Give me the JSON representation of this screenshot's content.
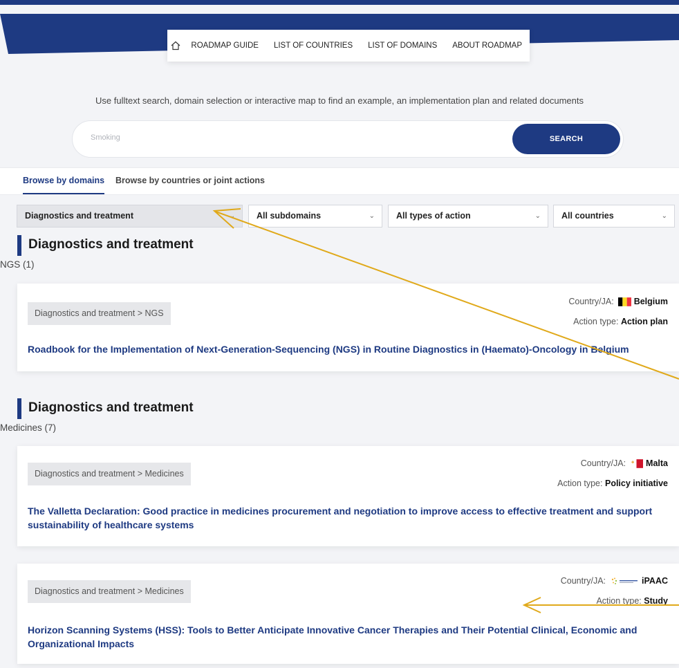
{
  "colors": {
    "brand": "#1e3a82",
    "annotation": "#e0a91a"
  },
  "nav": {
    "home_icon": "home-icon",
    "items": [
      {
        "label": "ROADMAP GUIDE"
      },
      {
        "label": "LIST OF COUNTRIES"
      },
      {
        "label": "LIST OF DOMAINS"
      },
      {
        "label": "ABOUT ROADMAP"
      }
    ]
  },
  "intro_text": "Use fulltext search, domain selection or interactive map to find an example, an implementation plan and related documents",
  "search": {
    "placeholder": "Smoking",
    "value": "",
    "button_label": "SEARCH"
  },
  "tabs": [
    {
      "label": "Browse by domains",
      "active": true
    },
    {
      "label": "Browse by countries or joint actions",
      "active": false
    }
  ],
  "filters": [
    {
      "label": "Diagnostics and treatment"
    },
    {
      "label": "All subdomains"
    },
    {
      "label": "All types of action"
    },
    {
      "label": "All countries"
    }
  ],
  "sections": [
    {
      "title": "Diagnostics and treatment",
      "subtitle": "NGS (1)",
      "cards": [
        {
          "crumb": "Diagnostics and treatment > NGS",
          "country_label": "Country/JA:",
          "country": "Belgium",
          "flag": "belgium-flag",
          "action_label": "Action type:",
          "action_type": "Action plan",
          "title": "Roadbook for the Implementation of Next-Generation-Sequencing (NGS) in Routine Diagnostics in (Haemato)-Oncology in Belgium"
        }
      ]
    },
    {
      "title": "Diagnostics and treatment",
      "subtitle": "Medicines (7)",
      "cards": [
        {
          "crumb": "Diagnostics and treatment > Medicines",
          "country_label": "Country/JA:",
          "country": "Malta",
          "flag": "malta-flag",
          "action_label": "Action type:",
          "action_type": "Policy initiative",
          "title": "The Valletta Declaration: Good practice in medicines procurement and negotiation to improve access to effective treatment and support sustainability of healthcare systems"
        },
        {
          "crumb": "Diagnostics and treatment > Medicines",
          "country_label": "Country/JA:",
          "country": "iPAAC",
          "flag": "ipaac-logo",
          "action_label": "Action type:",
          "action_type": "Study",
          "title": "Horizon Scanning Systems (HSS): Tools to Better Anticipate Innovative Cancer Therapies and Their Potential Clinical, Economic and Organizational Impacts"
        }
      ]
    }
  ]
}
